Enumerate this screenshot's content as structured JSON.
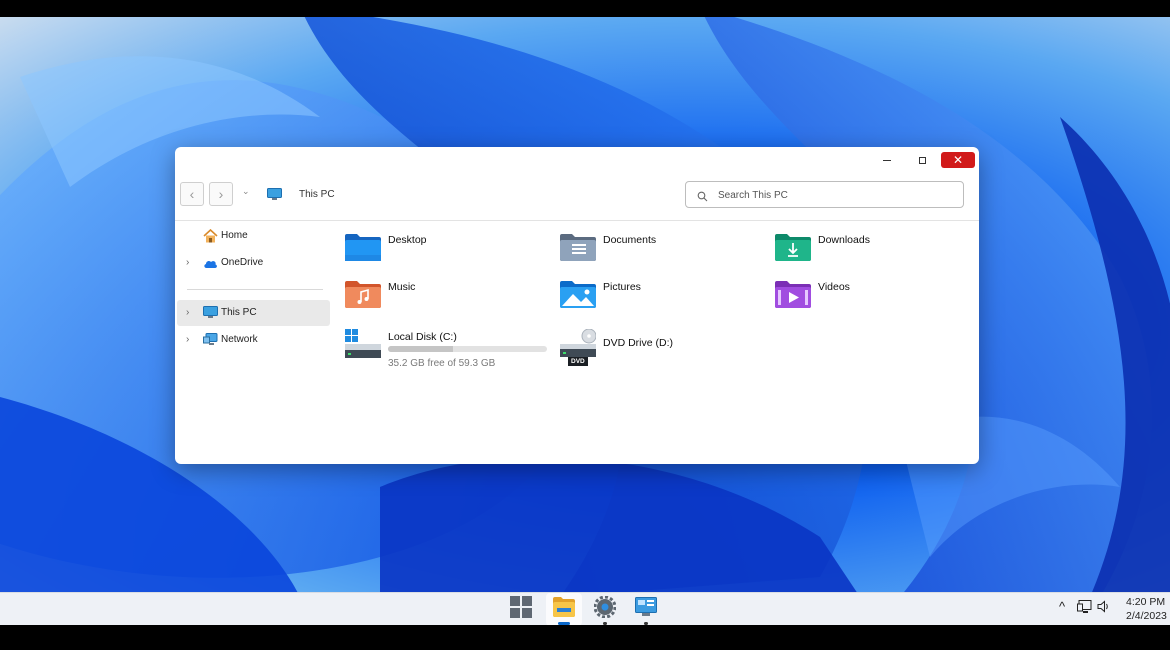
{
  "window": {
    "controls": {
      "close_glyph": "✕"
    }
  },
  "toolbar": {
    "back_glyph": "‹",
    "forward_glyph": "›",
    "recent_glyph": "⌄",
    "address": "This PC",
    "search_placeholder": "Search This PC"
  },
  "sidebar": {
    "items": [
      {
        "label": "Home",
        "icon": "home-icon",
        "chevron": ""
      },
      {
        "label": "OneDrive",
        "icon": "cloud-icon",
        "chevron": "›"
      },
      {
        "label": "This PC",
        "icon": "computer-icon",
        "chevron": "›",
        "selected": true
      },
      {
        "label": "Network",
        "icon": "network-icon",
        "chevron": "›"
      }
    ]
  },
  "folders": [
    {
      "label": "Desktop",
      "icon": "desktop-folder-icon"
    },
    {
      "label": "Documents",
      "icon": "documents-folder-icon"
    },
    {
      "label": "Downloads",
      "icon": "downloads-folder-icon"
    },
    {
      "label": "Music",
      "icon": "music-folder-icon"
    },
    {
      "label": "Pictures",
      "icon": "pictures-folder-icon"
    },
    {
      "label": "Videos",
      "icon": "videos-folder-icon"
    }
  ],
  "drives": [
    {
      "label": "Local Disk (C:)",
      "free_text": "35.2 GB free of 59.3 GB",
      "used_fraction": 0.41,
      "icon": "hard-drive-icon"
    },
    {
      "label": "DVD Drive (D:)",
      "icon": "dvd-drive-icon",
      "badge": "DVD"
    }
  ],
  "taskbar": {
    "apps": [
      "start-icon",
      "file-explorer-icon",
      "settings-icon",
      "control-panel-icon"
    ],
    "tray": {
      "chevron": "^",
      "volume": "🔈"
    },
    "time": "4:20 PM",
    "date": "2/4/2023"
  },
  "colors": {
    "close_button": "#d11a1a",
    "accent": "#0a67c9"
  }
}
